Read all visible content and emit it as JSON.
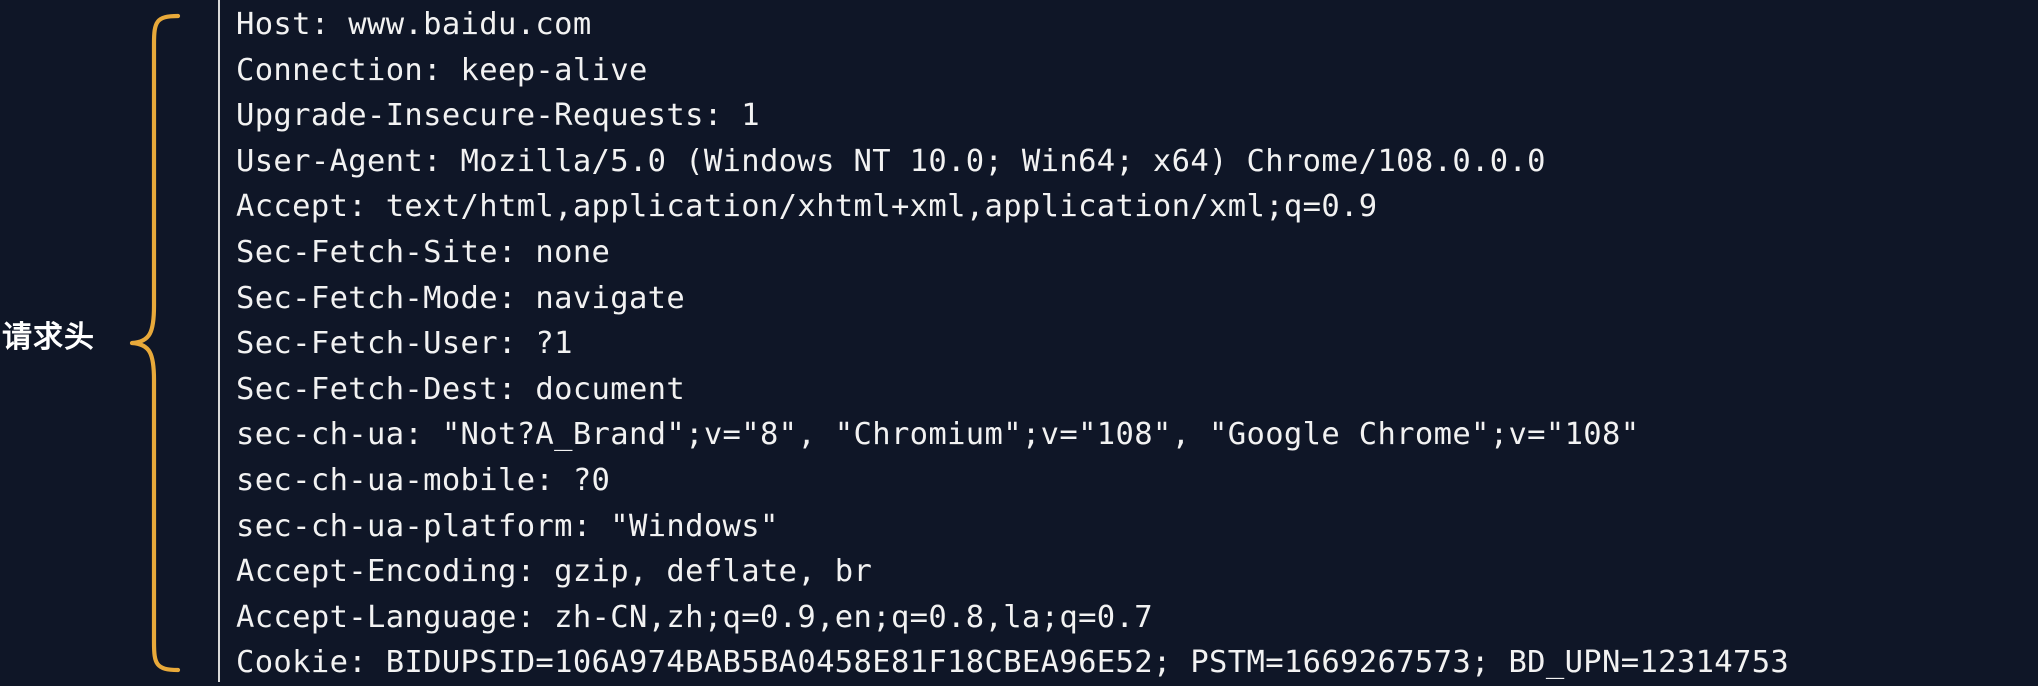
{
  "side_label": "请求头",
  "brace_color": "#e8a93a",
  "background_color": "#0f1627",
  "text_color": "#f2f2f2",
  "header_lines": [
    "Host: www.baidu.com",
    "Connection: keep-alive",
    "Upgrade-Insecure-Requests: 1",
    "User-Agent: Mozilla/5.0 (Windows NT 10.0; Win64; x64) Chrome/108.0.0.0",
    "Accept: text/html,application/xhtml+xml,application/xml;q=0.9",
    "Sec-Fetch-Site: none",
    "Sec-Fetch-Mode: navigate",
    "Sec-Fetch-User: ?1",
    "Sec-Fetch-Dest: document",
    "sec-ch-ua: \"Not?A_Brand\";v=\"8\", \"Chromium\";v=\"108\", \"Google Chrome\";v=\"108\"",
    "sec-ch-ua-mobile: ?0",
    "sec-ch-ua-platform: \"Windows\"",
    "Accept-Encoding: gzip, deflate, br",
    "Accept-Language: zh-CN,zh;q=0.9,en;q=0.8,la;q=0.7",
    "Cookie: BIDUPSID=106A974BAB5BA0458E81F18CBEA96E52; PSTM=1669267573; BD_UPN=12314753"
  ]
}
